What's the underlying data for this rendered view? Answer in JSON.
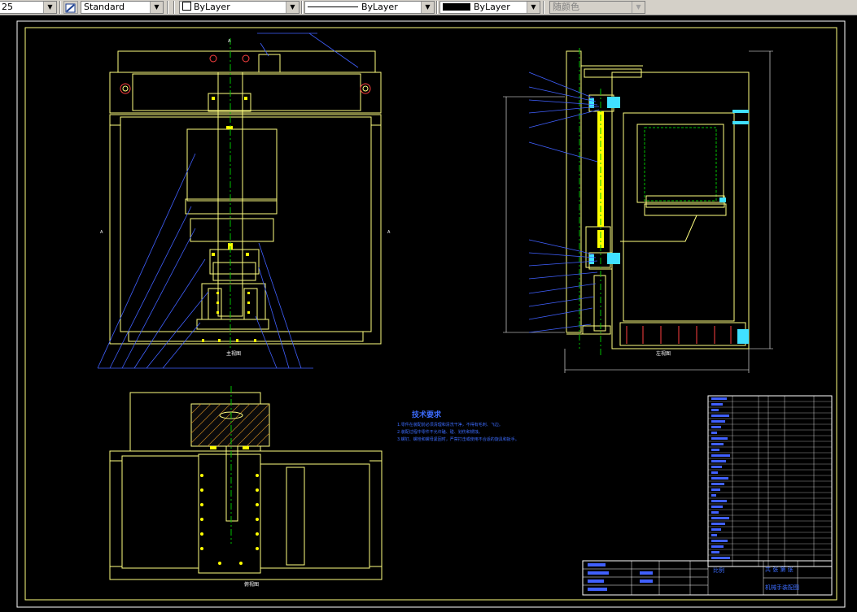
{
  "toolbar": {
    "scale_value": "25",
    "text_style": "Standard",
    "layer": "ByLayer",
    "linetype": "ByLayer",
    "lineweight": "ByLayer",
    "plot_style": "随颜色"
  },
  "drawing": {
    "tech_requirements_title": "技术要求",
    "notes": [
      "1.零件在装配前必须清理和清洗干净，不得有毛刺、飞边。",
      "2.装配过程中零件不允许磕、碰、划伤和锈蚀。",
      "3.螺钉、螺栓和螺母紧固时，严禁打击或使用不合适的旋具和扳手。"
    ],
    "front_view_label": "主视图",
    "side_view_label": "左视图",
    "bottom_view_label": "俯视图",
    "title_block": {
      "drawing_title": "机械手装配图",
      "scale_label": "比例",
      "sheet_label": "共 张 第 张"
    }
  },
  "colors": {
    "outline": "#ffff80",
    "center_line": "#00c000",
    "leader": "#4060ff",
    "highlight": "#ffff00",
    "hatch": "#c08020",
    "bolt": "#ff4040",
    "white": "#ffffff",
    "cyan": "#40e0ff"
  }
}
